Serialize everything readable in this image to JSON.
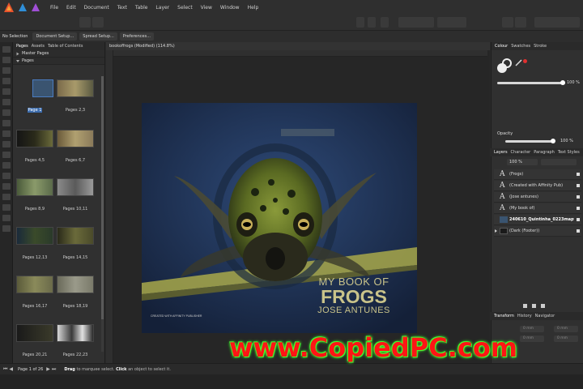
{
  "menubar": {
    "items": [
      "File",
      "Edit",
      "Document",
      "Text",
      "Table",
      "Layer",
      "Select",
      "View",
      "Window",
      "Help"
    ]
  },
  "contextbar": {
    "selection": "No Selection",
    "buttons": [
      "Document Setup...",
      "Spread Setup...",
      "Preferences..."
    ]
  },
  "pages_panel": {
    "tabs": [
      "Pages",
      "Assets",
      "Table of Contents"
    ],
    "sections": [
      "Master Pages",
      "Pages"
    ],
    "spreads": [
      {
        "label": "Page 1",
        "selected": true
      },
      {
        "label": "Pages 2,3"
      },
      {
        "label": "Pages 4,5"
      },
      {
        "label": "Pages 6,7"
      },
      {
        "label": "Pages 8,9"
      },
      {
        "label": "Pages 10,11"
      },
      {
        "label": "Pages 12,13"
      },
      {
        "label": "Pages 14,15"
      },
      {
        "label": "Pages 16,17"
      },
      {
        "label": "Pages 18,19"
      },
      {
        "label": "Pages 20,21"
      },
      {
        "label": "Pages 22,23"
      }
    ]
  },
  "document": {
    "tab_title": "bookoffrogs (Modified) (114.8%)",
    "cover": {
      "line1": "MY BOOK OF",
      "line2": "FROGS",
      "line3": "JOSE ANTUNES",
      "credit": "CREATED WITH AFFINITY PUBLISHER"
    }
  },
  "right_panel": {
    "colour_tabs": [
      "Colour",
      "Swatches",
      "Stroke"
    ],
    "opacity_label": "Opacity",
    "opacity_value": "100 %",
    "tint_value": "100 %",
    "layers_tabs": [
      "Layers",
      "Character",
      "Paragraph",
      "Text Styles"
    ],
    "layers_opacity": "100 %",
    "layers": [
      {
        "glyph": "A",
        "name": "(Frogs)"
      },
      {
        "glyph": "A",
        "name": "(Created with Affinity Pub)"
      },
      {
        "glyph": "A",
        "name": "(Jose antunes)"
      },
      {
        "glyph": "A",
        "name": "(My book of)"
      },
      {
        "glyph": "",
        "name": "240610_Quintinha_0223mapta",
        "bold": true
      },
      {
        "glyph": "",
        "name": "(Dark (Footer))"
      }
    ],
    "transform_tabs": [
      "Transform",
      "History",
      "Navigator"
    ],
    "transform_fields": [
      "0 mm",
      "0 mm",
      "0 mm",
      "0 mm"
    ]
  },
  "statusbar": {
    "page": "Page 1 of 26",
    "hint_action": "Drag",
    "hint_text": "to marquee select.",
    "hint_action2": "Click",
    "hint_text2": "an object to select it."
  },
  "watermark": {
    "text": "www.CopiedPC.com"
  },
  "colors": {
    "accent": "#3c6cad",
    "brand_red": "#e8532c",
    "cover_title": "#c9c38a",
    "watermark": "#ff1515"
  }
}
